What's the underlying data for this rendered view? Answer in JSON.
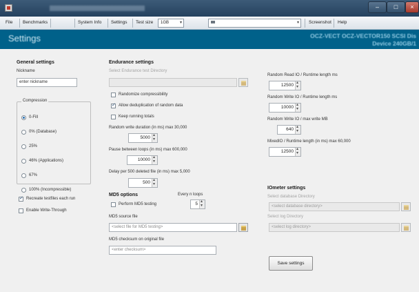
{
  "window": {
    "title": "",
    "title_rest": ""
  },
  "menu": {
    "file": "File",
    "benchmarks": "Benchmarks",
    "iometer": "",
    "system_info": "System Info",
    "settings": "Settings",
    "test_size_label": "Test size",
    "test_size_value": "1GB",
    "drive_label": "",
    "drive_value": "",
    "screenshot": "Screenshot",
    "help": "Help"
  },
  "header": {
    "title": "Settings",
    "device_line1": "OCZ-VECT OCZ-VECTOR150 SCSI Dis",
    "device_line2": "Device 240GB/1"
  },
  "general": {
    "title": "General settings",
    "nickname_label": "Nickname",
    "nickname_value": "enter nickname",
    "compression_title": "Compression",
    "options": [
      "0-Fill",
      "0% (Database)",
      "25%",
      "46% (Applications)",
      "67%",
      "100% (Incompressible)"
    ],
    "selected_index": 0,
    "recreate_label": "Recreate testfiles each run",
    "recreate_checked": true,
    "write_through_label": "Enable Write-Through",
    "write_through_checked": false
  },
  "endurance": {
    "title": "Endurance settings",
    "dir_label": "Select Endurance test Directory",
    "dir_value": "",
    "randomize_label": "Randomize compressibility",
    "randomize_checked": false,
    "dedup_label": "Allow deduplication of random data",
    "dedup_checked": true,
    "keep_totals_label": "Keep running totals",
    "keep_totals_checked": false,
    "random_write_label": "Random write duration (in ms) max 30,000",
    "random_write_value": "5000",
    "pause_label": "Pause between loops (in ms) max 600,000",
    "pause_value": "10000",
    "delay_label": "Delay per 500 deleted file (in ms) max 5,000",
    "delay_value": "500"
  },
  "md5": {
    "title": "MD5 options",
    "every_n_label": "Every n loops",
    "every_n_value": "5",
    "perform_label": "Perform MD5 testing",
    "perform_checked": false,
    "source_label": "MD5 source file",
    "source_placeholder": "<select file for MD5 testing>",
    "checksum_label": "MD5 checksum on original file",
    "checksum_placeholder": "<enter checksum>"
  },
  "random": {
    "read_label": "Random Read IO / Runtime length ms",
    "read_value": "12500",
    "write_label": "Random Write IO / Runtime length ms",
    "write_value": "10000",
    "write_max_label": "Random Write IO / max write MB",
    "write_max_value": "640",
    "mixed_label": "MixedIO / Runtime length (in ms) max 60,000",
    "mixed_value": "12500"
  },
  "iometer": {
    "title": "IOmeter settings",
    "db_label": "Select database Directory",
    "db_placeholder": "<select database directory>",
    "log_label": "Select log Directory",
    "log_placeholder": "<select log directory>"
  },
  "save_label": "Save settings",
  "watermark": ""
}
